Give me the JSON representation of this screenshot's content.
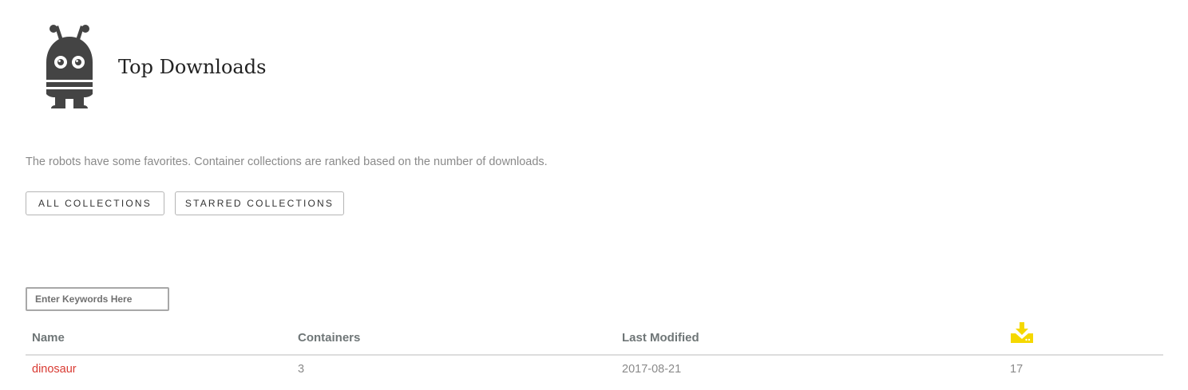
{
  "header": {
    "title": "Top Downloads",
    "logo_icon": "robot-logo-icon"
  },
  "description": "The robots have some favorites. Container collections are ranked based on the number of downloads.",
  "buttons": {
    "all_collections": "All Collections",
    "starred_collections": "Starred Collections"
  },
  "search": {
    "placeholder": "Enter Keywords Here",
    "value": ""
  },
  "table": {
    "columns": {
      "name": "Name",
      "containers": "Containers",
      "last_modified": "Last Modified",
      "downloads_icon": "download-icon"
    },
    "rows": [
      {
        "name": "dinosaur",
        "containers": "3",
        "last_modified": "2017-08-21",
        "downloads": "17"
      }
    ]
  },
  "colors": {
    "accent_link": "#d93a32",
    "download_icon": "#f5d800",
    "robot": "#444444"
  }
}
